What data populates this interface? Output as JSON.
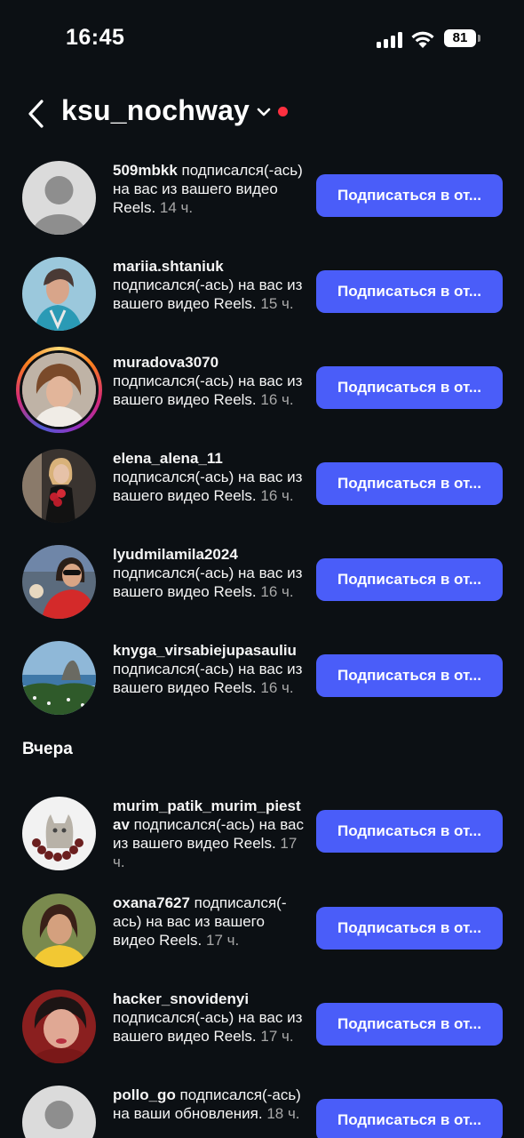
{
  "status_bar": {
    "time": "16:45",
    "battery": "81"
  },
  "header": {
    "title": "ksu_nochway"
  },
  "follow_button_label": "Подписаться в от...",
  "section_yesterday": "Вчера",
  "notifications": [
    {
      "username": "509mbkk",
      "text": " подписался(-ась) на вас из вашего видео Reels.",
      "time": " 14 ч."
    },
    {
      "username": "mariia.shtaniuk",
      "text": " подписался(-ась) на вас из вашего видео Reels.",
      "time": " 15 ч."
    },
    {
      "username": "muradova3070",
      "text": " подписался(-ась) на вас из вашего видео Reels.",
      "time": " 16 ч."
    },
    {
      "username": "elena_alena_11",
      "text": " подписался(-ась) на вас из вашего видео Reels.",
      "time": " 16 ч."
    },
    {
      "username": "lyudmilamila2024",
      "text": " подписался(-ась) на вас из вашего видео Reels.",
      "time": " 16 ч."
    },
    {
      "username": "knyga_virsabiejupasauliu",
      "text": " подписался(-ась) на вас из вашего видео Reels.",
      "time": " 16 ч."
    },
    {
      "username": "murim_patik_murim_piestav",
      "text": " подписался(-ась) на вас из вашего видео Reels.",
      "time": " 17 ч."
    },
    {
      "username": "oxana7627",
      "text": " подписался(-ась) на вас из вашего видео Reels.",
      "time": " 17 ч."
    },
    {
      "username": "hacker_snovidenyi",
      "text": " подписался(-ась) на вас из вашего видео Reels.",
      "time": " 17 ч."
    },
    {
      "username": "pollo_go",
      "text": " подписался(-ась) на ваши обновления.",
      "time": " 18 ч."
    }
  ],
  "colors": {
    "background": "#0c1014",
    "button": "#4a5df9",
    "muted": "#a8a8a8",
    "notification_dot": "#ff3040"
  }
}
